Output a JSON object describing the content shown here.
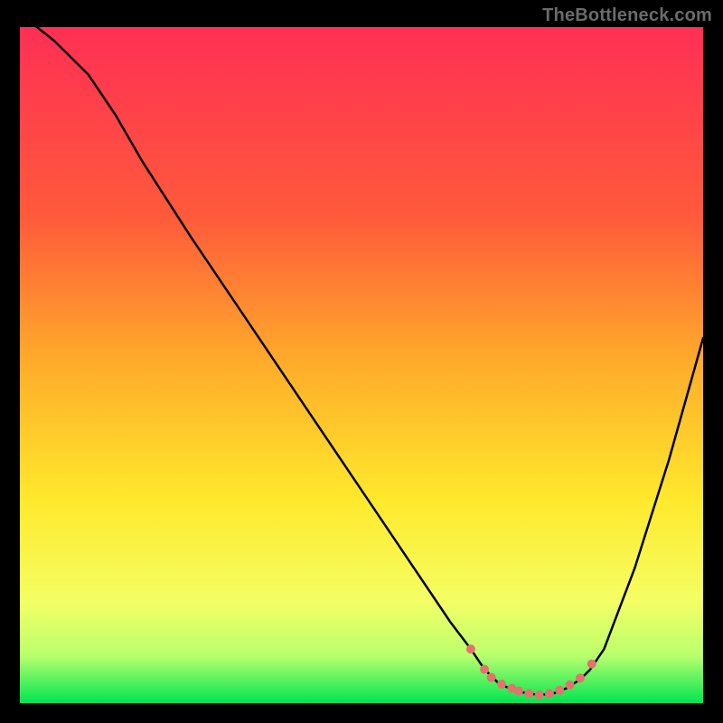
{
  "watermark": "TheBottleneck.com",
  "chart_data": {
    "type": "line",
    "title": "",
    "xlabel": "",
    "ylabel": "",
    "xlim": [
      0,
      100
    ],
    "ylim": [
      0,
      100
    ],
    "grid": false,
    "legend": false,
    "background_gradient_stops": [
      {
        "offset": 0,
        "color": "#ff2f55"
      },
      {
        "offset": 28,
        "color": "#ff5a3b"
      },
      {
        "offset": 50,
        "color": "#ffad2a"
      },
      {
        "offset": 70,
        "color": "#ffe92c"
      },
      {
        "offset": 85,
        "color": "#f4ff65"
      },
      {
        "offset": 93,
        "color": "#b9ff6d"
      },
      {
        "offset": 100,
        "color": "#00e552"
      }
    ],
    "series": [
      {
        "name": "bottleneck-curve",
        "stroke": "#000000",
        "stroke_width": 2.5,
        "x": [
          0,
          5,
          10,
          14,
          18,
          25,
          35,
          45,
          55,
          63,
          66,
          68,
          70,
          72,
          74,
          76,
          78,
          80,
          82,
          83.5,
          85.5,
          90,
          95,
          100
        ],
        "y": [
          102,
          98,
          93,
          87,
          80,
          69,
          54,
          39,
          24,
          12,
          8,
          5,
          3,
          2,
          1.5,
          1.2,
          1.4,
          2.2,
          3.5,
          5,
          8,
          20,
          36,
          54
        ]
      }
    ],
    "marker_series": {
      "name": "optimal-zone-markers",
      "color": "#e2736e",
      "radius": 5,
      "points": [
        {
          "x": 66,
          "y": 8
        },
        {
          "x": 68,
          "y": 5
        },
        {
          "x": 69,
          "y": 3.8
        },
        {
          "x": 70.5,
          "y": 2.8
        },
        {
          "x": 72,
          "y": 2.2
        },
        {
          "x": 73,
          "y": 1.8
        },
        {
          "x": 74.5,
          "y": 1.4
        },
        {
          "x": 76,
          "y": 1.2
        },
        {
          "x": 77.5,
          "y": 1.4
        },
        {
          "x": 79,
          "y": 1.9
        },
        {
          "x": 80.5,
          "y": 2.7
        },
        {
          "x": 82,
          "y": 3.7
        },
        {
          "x": 83.7,
          "y": 5.8
        }
      ]
    }
  }
}
